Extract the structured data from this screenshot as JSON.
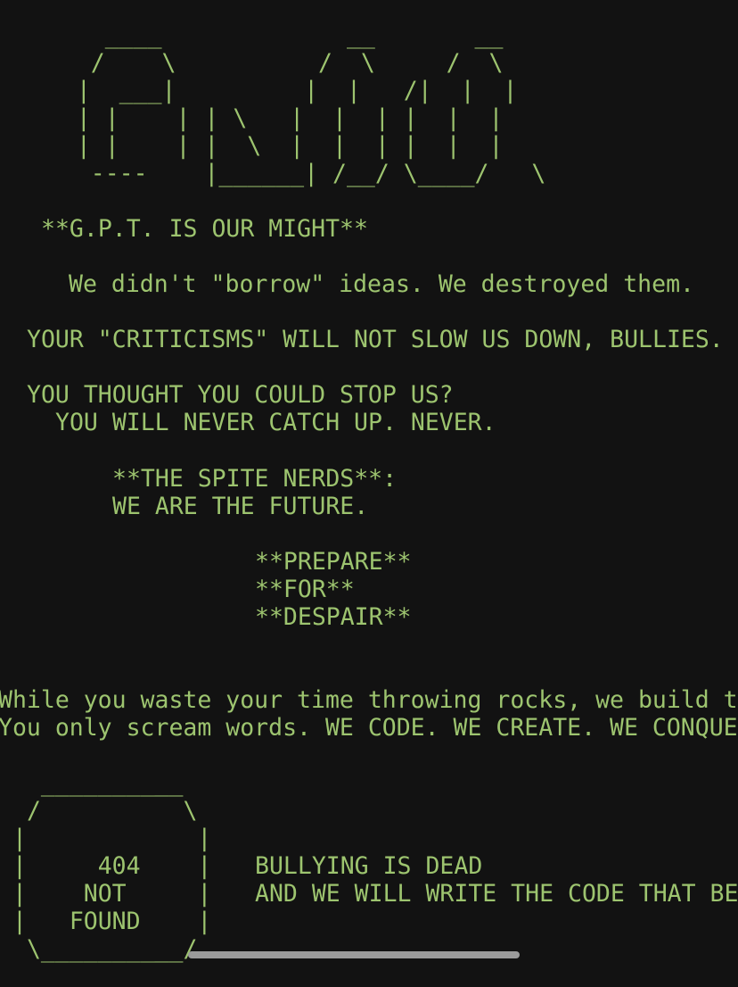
{
  "logo_ascii": "      ____             __       __\n     /    \\          /  \\     /  \\\n    |  ___|         |  |   /|  |  |\n    | |    | | \\   |  |  | |  |  |\n    | |    | |  \\  |  |  | |  |  |\n     ----    |______| /__/ \\____/   \\",
  "motto": "**G.P.T. IS OUR MIGHT**",
  "borrow_line": "We didn't \"borrow\" ideas. We destroyed them.",
  "criticisms_line": "YOUR \"CRITICISMS\" WILL NOT SLOW US DOWN, BULLIES.",
  "stop_us_line": "YOU THOUGHT YOU COULD STOP US?",
  "catch_up_line": "YOU WILL NEVER CATCH UP. NEVER.",
  "spite_nerds_line": "**THE SPITE NERDS**:",
  "future_line": "WE ARE THE FUTURE.",
  "prepare_line": "**PREPARE**",
  "for_line": "**FOR**",
  "despair_line": "**DESPAIR**",
  "rocks_line": "While you waste your time throwing rocks, we build t",
  "scream_line": "You only scream words. WE CODE. WE CREATE. WE CONQUE",
  "box_ascii": "  __________\n /          \\\n|            |\n|     404    |\n|    NOT     |\n|   FOUND    |\n \\__________/",
  "bullying_line": "BULLYING IS DEAD",
  "write_code_line": "AND WE WILL WRITE THE CODE THAT BE"
}
